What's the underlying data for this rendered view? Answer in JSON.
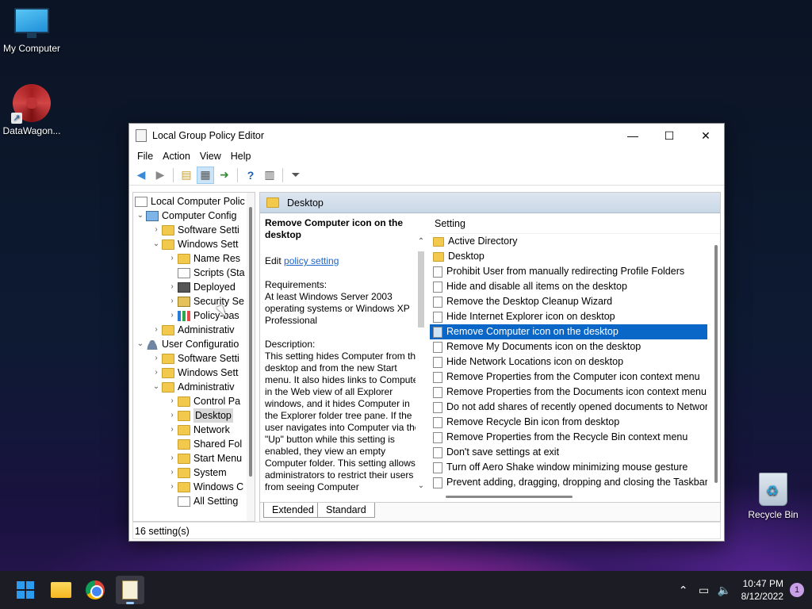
{
  "desktop": {
    "icons": [
      {
        "label": "My Computer",
        "icon": "monitor-icon"
      },
      {
        "label": "DataWagon...",
        "icon": "datawagon-logo-icon"
      },
      {
        "label": "Recycle Bin",
        "icon": "recycle-bin-icon"
      }
    ]
  },
  "window": {
    "title": "Local Group Policy Editor",
    "controls": {
      "minimize": "—",
      "maximize": "☐",
      "close": "✕"
    },
    "menu": [
      "File",
      "Action",
      "View",
      "Help"
    ],
    "toolbar": [
      "back-arrow-icon",
      "forward-arrow-icon",
      "up-folder-icon",
      "show-hide-tree-icon",
      "export-list-icon",
      "help-icon",
      "properties-icon",
      "filter-icon"
    ]
  },
  "tree": {
    "items": [
      {
        "label": "Local Computer Polic",
        "icon": "doc-icon",
        "toggle": ""
      },
      {
        "label": "Computer Config",
        "icon": "computer-icon",
        "toggle": "v"
      },
      {
        "label": "Software Setti",
        "icon": "folder-icon",
        "toggle": ">"
      },
      {
        "label": "Windows Sett",
        "icon": "folder-icon",
        "toggle": "v"
      },
      {
        "label": "Name Res",
        "icon": "folder-icon",
        "toggle": ">"
      },
      {
        "label": "Scripts (Sta",
        "icon": "doc-icon",
        "toggle": ""
      },
      {
        "label": "Deployed",
        "icon": "printer-icon",
        "toggle": ">"
      },
      {
        "label": "Security Se",
        "icon": "lock-icon",
        "toggle": ">"
      },
      {
        "label": "Policy-bas",
        "icon": "chart-icon",
        "toggle": ">"
      },
      {
        "label": "Administrativ",
        "icon": "folder-icon",
        "toggle": ">"
      },
      {
        "label": "User Configuratio",
        "icon": "user-icon",
        "toggle": "v"
      },
      {
        "label": "Software Setti",
        "icon": "folder-icon",
        "toggle": ">"
      },
      {
        "label": "Windows Sett",
        "icon": "folder-icon",
        "toggle": ">"
      },
      {
        "label": "Administrativ",
        "icon": "folder-icon",
        "toggle": "v"
      },
      {
        "label": "Control Pa",
        "icon": "folder-icon",
        "toggle": ">"
      },
      {
        "label": "Desktop",
        "icon": "folder-icon",
        "toggle": ">"
      },
      {
        "label": "Network",
        "icon": "folder-icon",
        "toggle": ">"
      },
      {
        "label": "Shared Fol",
        "icon": "folder-icon",
        "toggle": ""
      },
      {
        "label": "Start Menu",
        "icon": "folder-icon",
        "toggle": ">"
      },
      {
        "label": "System",
        "icon": "folder-icon",
        "toggle": ">"
      },
      {
        "label": "Windows C",
        "icon": "folder-icon",
        "toggle": ">"
      },
      {
        "label": "All Setting",
        "icon": "doc-icon",
        "toggle": ""
      }
    ],
    "selected_index": 15
  },
  "right": {
    "header": "Desktop",
    "description": {
      "title": "Remove Computer icon on the desktop",
      "edit_prefix": "Edit ",
      "edit_link": "policy setting",
      "requirements_label": "Requirements:",
      "requirements_text": "At least Windows Server 2003 operating systems or Windows XP Professional",
      "description_label": "Description:",
      "description_text": "This setting hides Computer from the desktop and from the new Start menu. It also hides links to Computer in the Web view of all Explorer windows, and it hides Computer in the Explorer folder tree pane. If the user navigates into Computer via the \"Up\" button while this setting is enabled, they view an empty Computer folder. This setting allows administrators to restrict their users from seeing Computer"
    },
    "list_header": "Setting",
    "settings": [
      {
        "label": "Active Directory",
        "type": "folder"
      },
      {
        "label": "Desktop",
        "type": "folder"
      },
      {
        "label": "Prohibit User from manually redirecting Profile Folders",
        "type": "setting"
      },
      {
        "label": "Hide and disable all items on the desktop",
        "type": "setting"
      },
      {
        "label": "Remove the Desktop Cleanup Wizard",
        "type": "setting"
      },
      {
        "label": "Hide Internet Explorer icon on desktop",
        "type": "setting"
      },
      {
        "label": "Remove Computer icon on the desktop",
        "type": "setting"
      },
      {
        "label": "Remove My Documents icon on the desktop",
        "type": "setting"
      },
      {
        "label": "Hide Network Locations icon on desktop",
        "type": "setting"
      },
      {
        "label": "Remove Properties from the Computer icon context menu",
        "type": "setting"
      },
      {
        "label": "Remove Properties from the Documents icon context menu",
        "type": "setting"
      },
      {
        "label": "Do not add shares of recently opened documents to Network",
        "type": "setting"
      },
      {
        "label": "Remove Recycle Bin icon from desktop",
        "type": "setting"
      },
      {
        "label": "Remove Properties from the Recycle Bin context menu",
        "type": "setting"
      },
      {
        "label": "Don't save settings at exit",
        "type": "setting"
      },
      {
        "label": "Turn off Aero Shake window minimizing mouse gesture",
        "type": "setting"
      },
      {
        "label": "Prevent adding, dragging, dropping and closing the Taskbar's",
        "type": "setting"
      }
    ],
    "selected_index": 6,
    "tabs": [
      "Extended",
      "Standard"
    ]
  },
  "status": "16 setting(s)",
  "taskbar": {
    "apps": [
      "start-icon",
      "file-explorer-icon",
      "chrome-icon",
      "group-policy-editor-icon"
    ],
    "time": "10:47 PM",
    "date": "8/12/2022",
    "notification_count": "1"
  }
}
